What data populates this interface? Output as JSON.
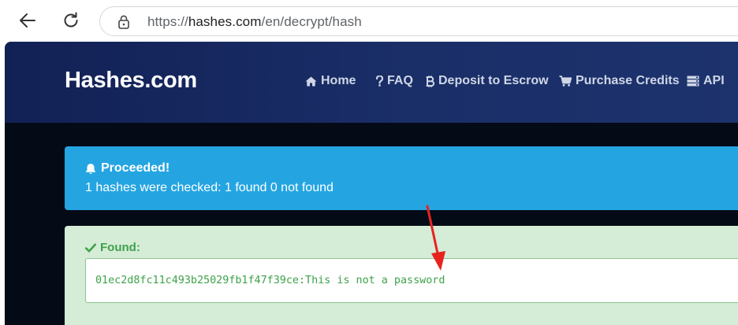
{
  "browser": {
    "url_prefix": "https://",
    "url_domain": "hashes.com",
    "url_path": "/en/decrypt/hash"
  },
  "site": {
    "logo": "Hashes.com",
    "nav": [
      {
        "label": "Home",
        "icon": "home-icon"
      },
      {
        "label": "FAQ",
        "icon": "question-icon"
      },
      {
        "label": "Deposit to Escrow",
        "icon": "bitcoin-icon"
      },
      {
        "label": "Purchase Credits",
        "icon": "cart-icon"
      },
      {
        "label": "API",
        "icon": "server-icon"
      }
    ]
  },
  "alert_info": {
    "title": "Proceeded!",
    "icon": "bell-icon",
    "message": "1 hashes were checked: 1 found 0 not found"
  },
  "alert_success": {
    "title": "Found:",
    "icon": "check-icon",
    "result": "01ec2d8fc11c493b25029fb1f47f39ce:This is not a password"
  },
  "colors": {
    "header": "#1a2e68",
    "page_background": "#050a17",
    "info": "#24a5e2",
    "success_bg": "#d5ecd7",
    "success_text": "#3ea24a",
    "annotation_arrow": "#e8231f"
  }
}
